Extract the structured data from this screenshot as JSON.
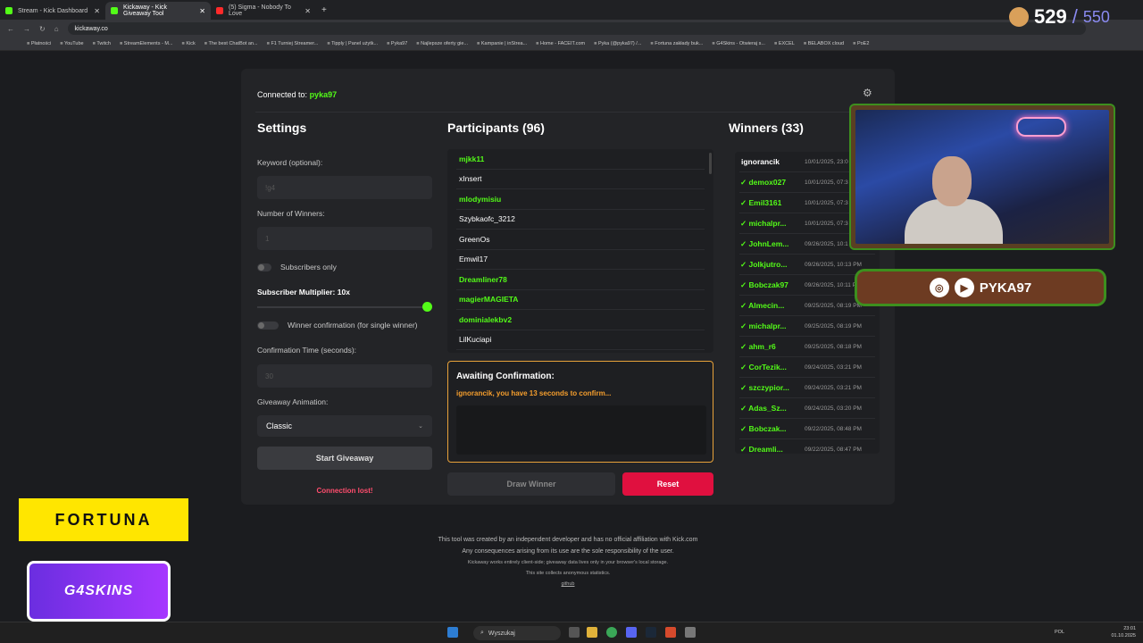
{
  "browser": {
    "tabs": [
      {
        "label": "Stream - Kick Dashboard",
        "color": "#53fc18"
      },
      {
        "label": "Kickaway - Kick Giveaway Tool",
        "color": "#53fc18"
      },
      {
        "label": "(5) Sigma - Nobody To Love",
        "color": "#ff2a2a"
      }
    ],
    "url": "kickaway.co",
    "bookmarks": [
      "Płatności",
      "YouTube",
      "Twitch",
      "StreamElements - M...",
      "Kick",
      "The best ChatBot an...",
      "F1 Turniej Streamer...",
      "Tipply | Panel użytk...",
      "Pyka97",
      "Najlepsze oferty gie...",
      "Kampanie | inStrea...",
      "Home - FACEIT.com",
      "Pyka (@pyka97) /...",
      "Fortuna zakłady buk...",
      "G4Skins - Otwieraj s...",
      "EXCEL",
      "BELABOX cloud",
      "PoE2"
    ]
  },
  "header": {
    "connected_label": "Connected to:",
    "channel": "pyka97"
  },
  "settings": {
    "title": "Settings",
    "keyword_label": "Keyword (optional):",
    "keyword_placeholder": "!g4",
    "winners_label": "Number of Winners:",
    "winners_value": "1",
    "subscribers_only": "Subscribers only",
    "multiplier_label": "Subscriber Multiplier: 10x",
    "multiplier_value": 10,
    "winner_confirmation": "Winner confirmation (for single winner)",
    "confirm_time_label": "Confirmation Time (seconds):",
    "confirm_time_value": "30",
    "animation_label": "Giveaway Animation:",
    "animation_value": "Classic",
    "start_button": "Start Giveaway",
    "connection_status": "Connection lost!"
  },
  "participants": {
    "title": "Participants (96)",
    "items": [
      {
        "name": "mjkk11",
        "subscriber": true
      },
      {
        "name": "xInsert",
        "subscriber": false
      },
      {
        "name": "mlodymisiu",
        "subscriber": true
      },
      {
        "name": "Szybkaofc_3212",
        "subscriber": false
      },
      {
        "name": "GreenOs",
        "subscriber": false
      },
      {
        "name": "Emwil17",
        "subscriber": false
      },
      {
        "name": "Dreamliner78",
        "subscriber": true
      },
      {
        "name": "magierMAGIETA",
        "subscriber": true
      },
      {
        "name": "dominialekbv2",
        "subscriber": true
      },
      {
        "name": "LilKuciapi",
        "subscriber": false
      }
    ]
  },
  "awaiting": {
    "title": "Awaiting Confirmation:",
    "message": "ignorancik, you have 13 seconds to confirm..."
  },
  "actions": {
    "draw": "Draw Winner",
    "reset": "Reset"
  },
  "winners": {
    "title": "Winners (33)",
    "items": [
      {
        "name": "ignorancik",
        "date": "10/01/2025, 23:0"
      },
      {
        "name": "✓ demox027",
        "date": "10/01/2025, 07:3"
      },
      {
        "name": "✓ Emil3161",
        "date": "10/01/2025, 07:3"
      },
      {
        "name": "✓ michalpr...",
        "date": "10/01/2025, 07:3"
      },
      {
        "name": "✓ JohnLem...",
        "date": "09/26/2025, 10:1"
      },
      {
        "name": "✓ Jolkjutro...",
        "date": "09/26/2025, 10:13 PM"
      },
      {
        "name": "✓ Bobczak97",
        "date": "09/26/2025, 10:11 PM"
      },
      {
        "name": "✓ Almecin...",
        "date": "09/25/2025, 08:19 PM"
      },
      {
        "name": "✓ michalpr...",
        "date": "09/25/2025, 08:19 PM"
      },
      {
        "name": "✓ ahm_r6",
        "date": "09/25/2025, 08:18 PM"
      },
      {
        "name": "✓ CorTezik...",
        "date": "09/24/2025, 03:21 PM"
      },
      {
        "name": "✓ szczypior...",
        "date": "09/24/2025, 03:21 PM"
      },
      {
        "name": "✓ Adas_Sz...",
        "date": "09/24/2025, 03:20 PM"
      },
      {
        "name": "✓ Bobczak...",
        "date": "09/22/2025, 08:48 PM"
      },
      {
        "name": "✓ Dreamli...",
        "date": "09/22/2025, 08:47 PM"
      }
    ]
  },
  "footer": {
    "line1": "This tool was created by an independent developer and has no official affiliation with Kick.com",
    "line2": "Any consequences arising from its use are the sole responsibility of the user.",
    "line3": "Kickaway works entirely client-side; giveaway data lives only in your browser's local storage.",
    "line4": "This site collects anonymous statistics.",
    "link": "github"
  },
  "overlay": {
    "viewers": "529",
    "viewers_total": "550",
    "nameplate": "PYKA97",
    "fortuna": "FORTUNA",
    "g4skins": "G4SKINS"
  },
  "taskbar": {
    "search": "Wyszukaj",
    "lang": "POL",
    "time": "23:01",
    "date": "01.10.2025"
  },
  "colors": {
    "accent": "#53fc18",
    "danger": "#e0103f",
    "warning": "#f59e2d"
  }
}
